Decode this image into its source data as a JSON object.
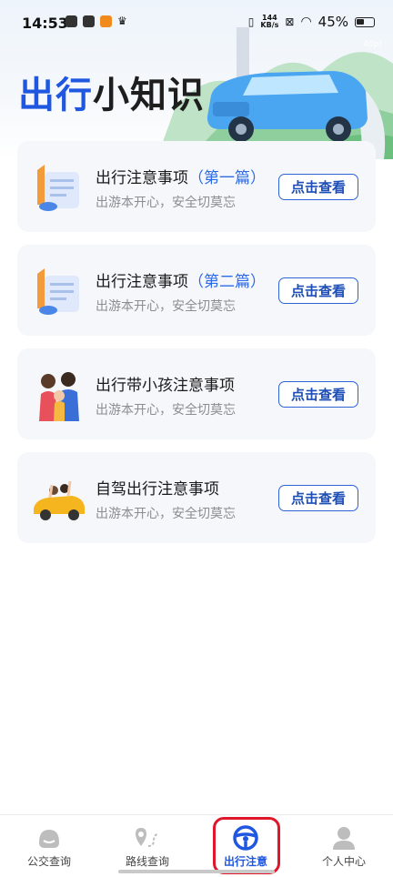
{
  "status_bar": {
    "time": "14:53",
    "net_speed_value": "144",
    "net_speed_unit": "KB/s",
    "battery": "45%"
  },
  "header": {
    "title_part1": "出行",
    "title_part2": "小知识",
    "watermark": "40pt"
  },
  "cards": [
    {
      "title": "出行注意事项",
      "highlight": "（第一篇）",
      "subtitle": "出游本开心，安全切莫忘",
      "button": "点击查看",
      "illustration": "document-scroll-illustration"
    },
    {
      "title": "出行注意事项",
      "highlight": "（第二篇）",
      "subtitle": "出游本开心，安全切莫忘",
      "button": "点击查看",
      "illustration": "document-scroll-illustration"
    },
    {
      "title": "出行带小孩注意事项",
      "highlight": "",
      "subtitle": "出游本开心，安全切莫忘",
      "button": "点击查看",
      "illustration": "family-illustration"
    },
    {
      "title": "自驾出行注意事项",
      "highlight": "",
      "subtitle": "出游本开心，安全切莫忘",
      "button": "点击查看",
      "illustration": "car-trip-illustration"
    }
  ],
  "tabs": [
    {
      "label": "公交查询",
      "icon": "bus-icon"
    },
    {
      "label": "路线查询",
      "icon": "route-icon"
    },
    {
      "label": "出行注意",
      "icon": "steering-wheel-icon",
      "active": true
    },
    {
      "label": "个人中心",
      "icon": "user-icon"
    }
  ],
  "colors": {
    "accent": "#1f57e0",
    "highlight_border": "#e0172b",
    "card_bg": "#f6f7fa"
  }
}
